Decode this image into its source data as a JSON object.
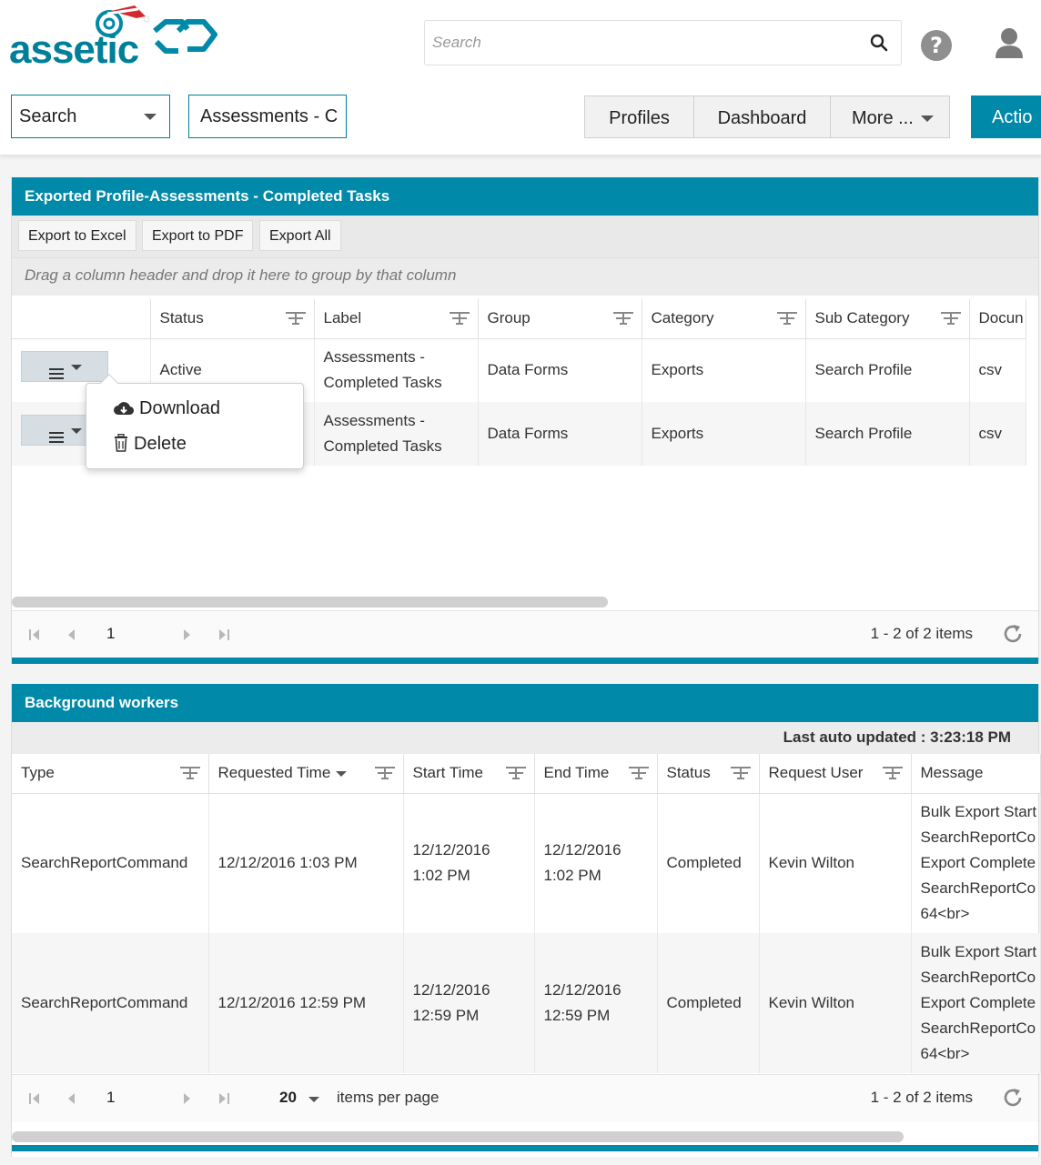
{
  "header": {
    "logo_text": "assetic",
    "search_placeholder": "Search",
    "nav_selects": {
      "search": "Search",
      "assessments": "Assessments - C"
    },
    "tabs": {
      "profiles": "Profiles",
      "dashboard": "Dashboard",
      "more": "More ..."
    },
    "action": "Actio"
  },
  "exports_panel": {
    "title": "Exported Profile-Assessments - Completed Tasks",
    "toolbar": {
      "excel": "Export to Excel",
      "pdf": "Export to PDF",
      "all": "Export All"
    },
    "group_hint": "Drag a column header and drop it here to group by that column",
    "columns": [
      "Status",
      "Label",
      "Group",
      "Category",
      "Sub Category",
      "Docun"
    ],
    "rows": [
      {
        "status": "Active",
        "label_line1": "Assessments -",
        "label_line2": "Completed Tasks",
        "group": "Data Forms",
        "category": "Exports",
        "subcategory": "Search Profile",
        "doc": "csv"
      },
      {
        "status": "",
        "label_line1": "Assessments -",
        "label_line2": "Completed Tasks",
        "group": "Data Forms",
        "category": "Exports",
        "subcategory": "Search Profile",
        "doc": "csv"
      }
    ],
    "menu": {
      "download": "Download",
      "delete": "Delete"
    },
    "pager": {
      "page": "1",
      "info": "1 - 2 of 2 items"
    }
  },
  "workers_panel": {
    "title": "Background workers",
    "last_updated": "Last auto updated : 3:23:18 PM",
    "columns": [
      "Type",
      "Requested Time",
      "Start Time",
      "End Time",
      "Status",
      "Request User",
      "Message"
    ],
    "rows": [
      {
        "type": "SearchReportCommand",
        "requested": "12/12/2016 1:03 PM",
        "start_date": "12/12/2016",
        "start_time": "1:02 PM",
        "end_date": "12/12/2016",
        "end_time": "1:02 PM",
        "status": "Completed",
        "user": "Kevin Wilton",
        "msg": [
          "Bulk Export Start",
          "SearchReportCo",
          "Export Complete",
          "SearchReportCo",
          "64<br>"
        ]
      },
      {
        "type": "SearchReportCommand",
        "requested": "12/12/2016 12:59 PM",
        "start_date": "12/12/2016",
        "start_time": "12:59 PM",
        "end_date": "12/12/2016",
        "end_time": "12:59 PM",
        "status": "Completed",
        "user": "Kevin Wilton",
        "msg": [
          "Bulk Export Start",
          "SearchReportCo",
          "Export Complete",
          "SearchReportCo",
          "64<br>"
        ]
      }
    ],
    "pager": {
      "page": "1",
      "per_page": "20",
      "per_page_label": "items per page",
      "info": "1 - 2 of 2 items"
    }
  },
  "colors": {
    "brand": "#0089a8",
    "logo": "#007f99",
    "row_menu": "#d6dee4"
  },
  "icons": [
    "search-icon",
    "help-icon",
    "user-icon",
    "filter-icon",
    "hamburger-icon",
    "cloud-download-icon",
    "trash-icon",
    "first-page-icon",
    "prev-page-icon",
    "next-page-icon",
    "last-page-icon",
    "refresh-icon"
  ]
}
